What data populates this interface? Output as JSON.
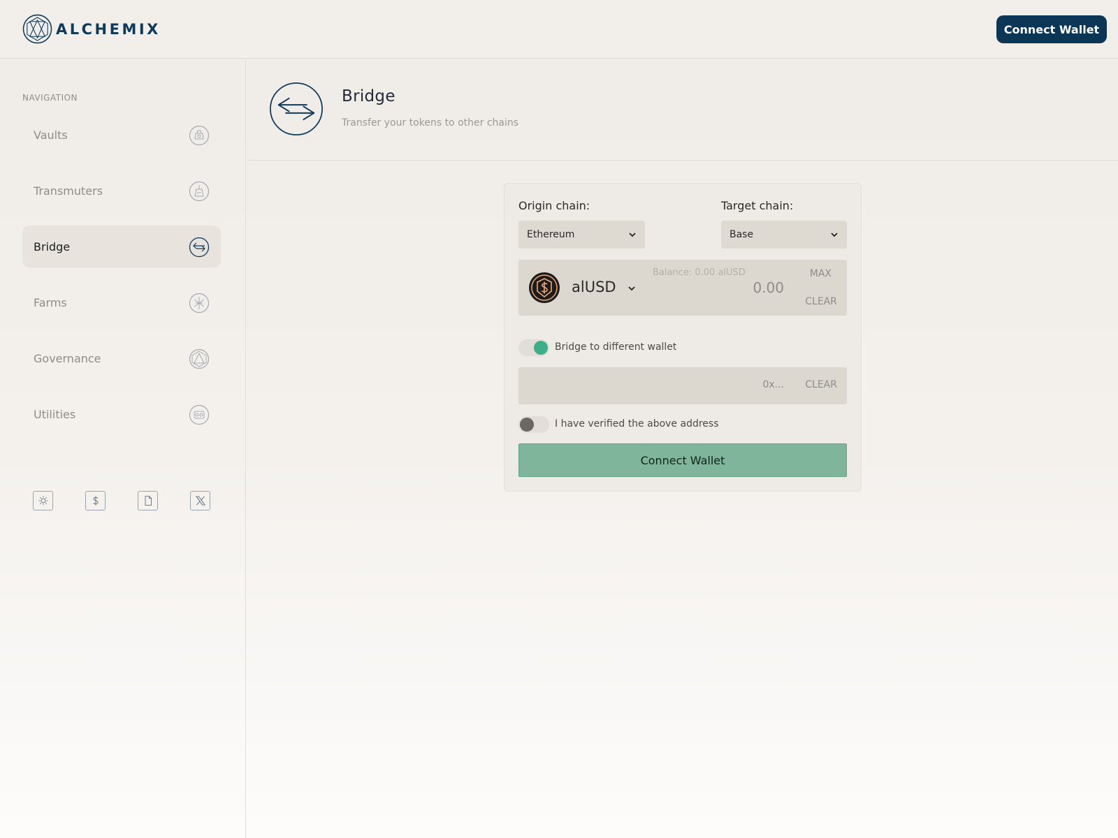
{
  "app": {
    "brand": "ALCHEMIX",
    "connect_wallet_label": "Connect Wallet"
  },
  "colors": {
    "brand_navy": "#0c3655",
    "accent_green": "#3daf88",
    "button_green": "#7fb59b"
  },
  "sidebar": {
    "heading": "NAVIGATION",
    "items": [
      {
        "label": "Vaults",
        "icon": "vault-icon",
        "active": false
      },
      {
        "label": "Transmuters",
        "icon": "transmuter-icon",
        "active": false
      },
      {
        "label": "Bridge",
        "icon": "bridge-icon",
        "active": true
      },
      {
        "label": "Farms",
        "icon": "farm-icon",
        "active": false
      },
      {
        "label": "Governance",
        "icon": "governance-icon",
        "active": false
      },
      {
        "label": "Utilities",
        "icon": "utilities-icon",
        "active": false
      }
    ],
    "footer_icons": [
      "sun-icon",
      "dollar-icon",
      "document-icon",
      "x-logo-icon"
    ]
  },
  "page": {
    "title": "Bridge",
    "subtitle": "Transfer your tokens to other chains",
    "icon": "bridge-arrows-icon"
  },
  "bridge": {
    "origin_label": "Origin chain:",
    "origin_value": "Ethereum",
    "target_label": "Target chain:",
    "target_value": "Base",
    "token": "alUSD",
    "balance_text": "Balance: 0.00 alUSD",
    "amount_placeholder": "0.00",
    "max_label": "MAX",
    "clear_label": "CLEAR",
    "different_wallet_label": "Bridge to different wallet",
    "different_wallet_on": true,
    "address_placeholder": "0x...",
    "verified_label": "I have verified the above address",
    "verified_on": false,
    "submit_label": "Connect Wallet"
  }
}
